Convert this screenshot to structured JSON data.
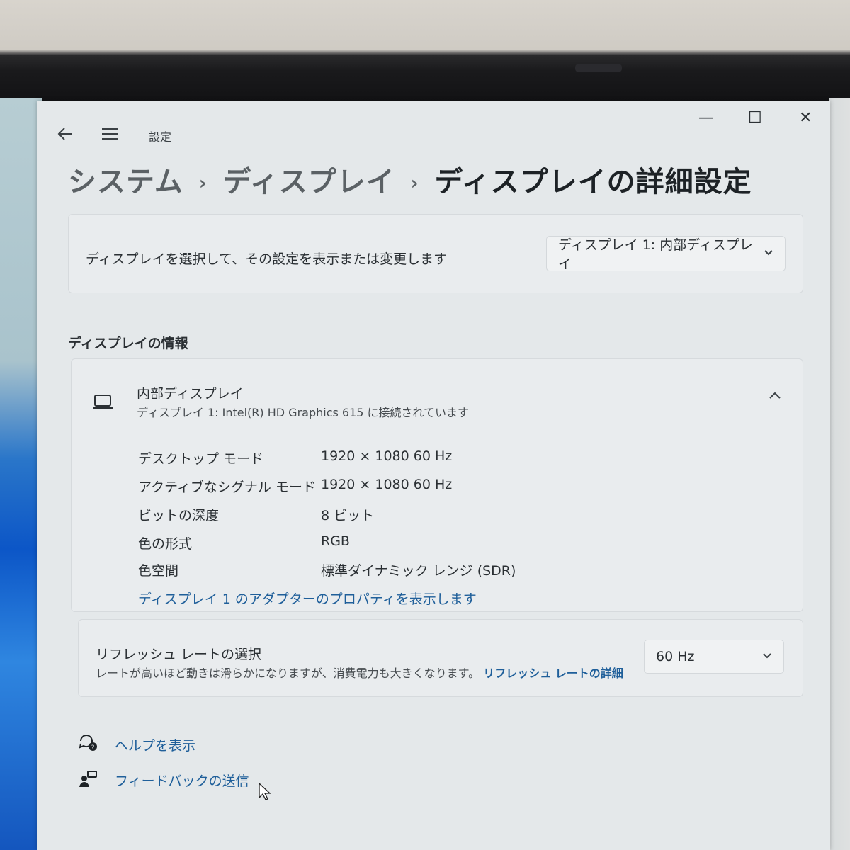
{
  "window": {
    "app_title": "設定",
    "back_icon": "back-arrow-icon",
    "menu_icon": "hamburger-menu-icon",
    "minimize": "—",
    "maximize": "☐",
    "close": "✕"
  },
  "breadcrumb": {
    "items": [
      "システム",
      "ディスプレイ",
      "ディスプレイの詳細設定"
    ],
    "separator": "›"
  },
  "display_select": {
    "label": "ディスプレイを選択して、その設定を表示または変更します",
    "selected": "ディスプレイ 1: 内部ディスプレイ"
  },
  "display_info": {
    "section_title": "ディスプレイの情報",
    "name": "内部ディスプレイ",
    "subtitle": "ディスプレイ 1: Intel(R) HD Graphics 615 に接続されています",
    "rows": [
      {
        "label": "デスクトップ モード",
        "value": "1920 × 1080 60 Hz"
      },
      {
        "label": "アクティブなシグナル モード",
        "value": "1920 × 1080 60 Hz"
      },
      {
        "label": "ビットの深度",
        "value": "8 ビット"
      },
      {
        "label": "色の形式",
        "value": "RGB"
      },
      {
        "label": "色空間",
        "value": "標準ダイナミック レンジ (SDR)"
      }
    ],
    "adapter_link": "ディスプレイ 1 のアダプターのプロパティを表示します"
  },
  "refresh": {
    "title": "リフレッシュ レートの選択",
    "description": "レートが高いほど動きは滑らかになりますが、消費電力も大きくなります。",
    "link": "リフレッシュ レートの詳細",
    "selected": "60 Hz"
  },
  "footer": {
    "help": "ヘルプを表示",
    "feedback": "フィードバックの送信"
  },
  "colors": {
    "link": "#1f5f9a",
    "window_bg": "#e4e8ea",
    "card_bg": "#e9ecee"
  }
}
